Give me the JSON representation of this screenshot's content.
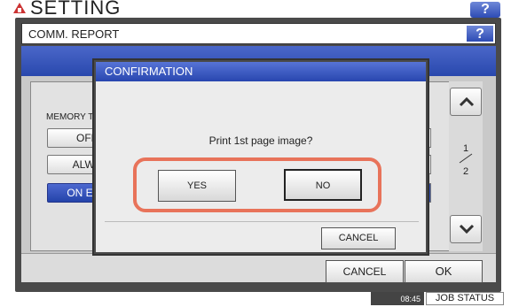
{
  "header": {
    "setting_title": "SETTING",
    "help_label": "?"
  },
  "panel": {
    "title": "COMM. REPORT",
    "help_label": "?",
    "memory_label": "MEMORY T",
    "options": [
      {
        "label": "OFF"
      },
      {
        "label": "ALWA"
      },
      {
        "label": "ON ERF",
        "selected": true
      }
    ],
    "pager": {
      "current": "1",
      "total": "2"
    },
    "cancel_label": "CANCEL",
    "ok_label": "OK"
  },
  "dialog": {
    "title": "CONFIRMATION",
    "message": "Print 1st page image?",
    "yes_label": "YES",
    "no_label": "NO",
    "cancel_label": "CANCEL",
    "highlight_color": "#e8735a"
  },
  "status": {
    "time": "08:45",
    "job_status_label": "JOB STATUS"
  },
  "colors": {
    "accent_blue": "#2d4bb4",
    "frame_dark": "#4a4a4a"
  }
}
